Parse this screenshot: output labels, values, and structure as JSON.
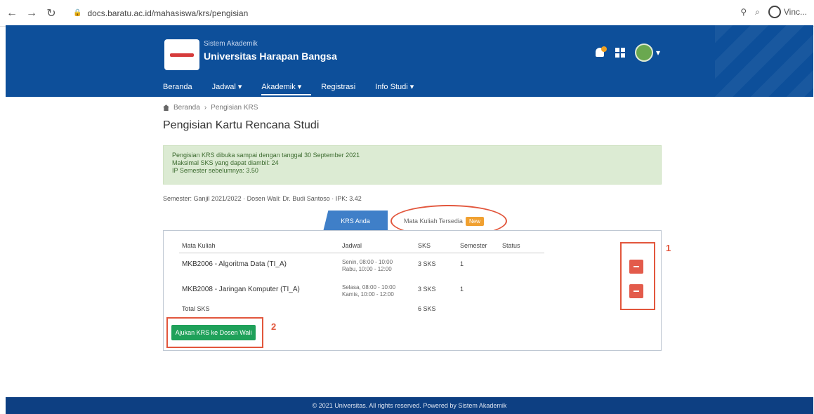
{
  "browser": {
    "back_icon": "arrow-left-icon",
    "forward_icon": "arrow-right-icon",
    "reload_icon": "reload-icon",
    "address": "docs.baratu.ac.id/mahasiswa/krs/pengisian",
    "profile_label": "Vinc..."
  },
  "header": {
    "subtitle": "Sistem Akademik",
    "title": "Universitas Harapan Bangsa",
    "nav": [
      {
        "label": "Beranda"
      },
      {
        "label": "Jadwal ▾"
      },
      {
        "label": "Akademik ▾"
      },
      {
        "label": "Registrasi"
      },
      {
        "label": "Info Studi ▾"
      }
    ]
  },
  "breadcrumb": {
    "home": "Beranda",
    "current": "Pengisian KRS"
  },
  "page": {
    "title": "Pengisian Kartu Rencana Studi",
    "alert_lines": [
      "Pengisian KRS dibuka sampai dengan tanggal 30 September 2021",
      "Maksimal SKS yang dapat diambil: 24",
      "IP Semester sebelumnya: 3.50"
    ],
    "info_line": "Semester: Ganjil 2021/2022 · Dosen Wali: Dr. Budi Santoso · IPK: 3.42"
  },
  "tabs": {
    "active": "KRS Anda",
    "other": "Mata Kuliah Tersedia",
    "other_badge": "New"
  },
  "table": {
    "headers": [
      "Mata Kuliah",
      "Jadwal",
      "SKS",
      "Semester",
      "Status"
    ],
    "rows": [
      {
        "course": "MKB2006 - Algoritma Data (TI_A)",
        "time_1": "Senin, 08:00 - 10:00",
        "time_2": "Rabu, 10:00 - 12:00",
        "sks": "3 SKS",
        "semester": "1"
      },
      {
        "course": "MKB2008 - Jaringan Komputer (TI_A)",
        "time_1": "Selasa, 08:00 - 10:00",
        "time_2": "Kamis, 10:00 - 12:00",
        "sks": "3 SKS",
        "semester": "1"
      }
    ],
    "total_label": "Total SKS",
    "total_value": "6 SKS"
  },
  "actions": {
    "submit_label": "Ajukan KRS ke Dosen Wali"
  },
  "annotations": {
    "marker_1": "1",
    "marker_2": "2"
  },
  "footer": {
    "text": "© 2021 Universitas. All rights reserved. Powered by Sistem Akademik"
  },
  "colors": {
    "header_blue": "#0d4f9a",
    "footer_blue": "#0d3f82",
    "alert_green": "#dcebd3",
    "submit_green": "#1fa15a",
    "delete_red": "#e35b4b",
    "annotation_red": "#e2563c",
    "tab_blue": "#3f7fc8"
  }
}
